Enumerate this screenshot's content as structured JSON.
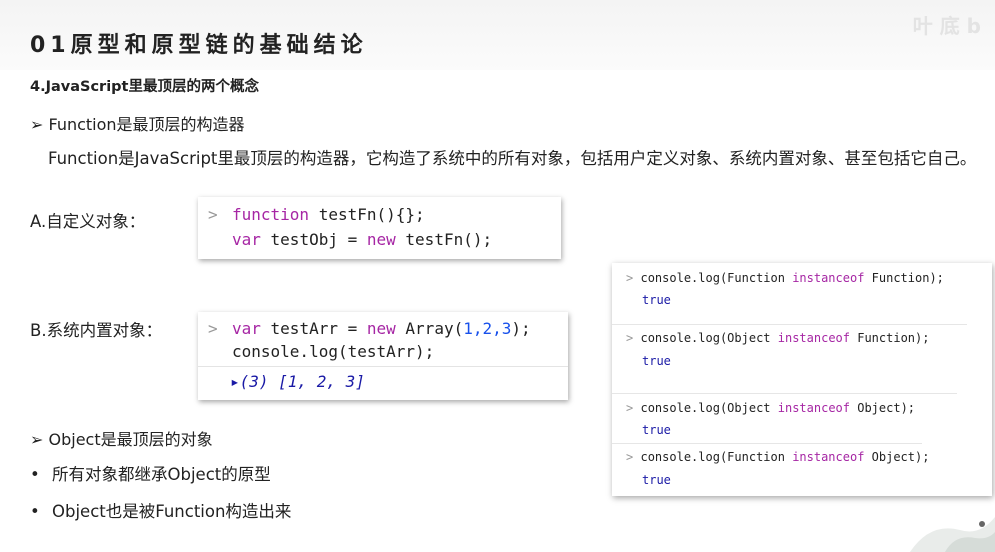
{
  "slide": {
    "title": "01原型和原型链的基础结论",
    "watermark": "叶 底 b",
    "subtitle": "4.JavaScript里最顶层的两个概念",
    "point1": "➢ Function是最顶层的构造器",
    "paragraph": "Function是JavaScript里最顶层的构造器，它构造了系统中的所有对象，包括用户定义对象、系统内置对象、甚至包括它自己。",
    "label_a": "A.自定义对象：",
    "label_b": "B.系统内置对象：",
    "point2": "➢ Object是最顶层的对象",
    "bullets": [
      "所有对象都继承Object的原型",
      "Object也是被Function构造出来"
    ],
    "bullet_char": "•"
  },
  "code_a": {
    "prompt": ">",
    "line1_kw": "function",
    "line1_rest": " testFn(){};",
    "line2_kw": "var",
    "line2_mid": " testObj = ",
    "line2_kw2": "new",
    "line2_rest": " testFn();"
  },
  "code_b": {
    "prompt": ">",
    "line1_kw": "var",
    "line1_mid": " testArr = ",
    "line1_kw2": "new",
    "line1_arr": " Array(",
    "line1_args": "1,2,3",
    "line1_end": ");",
    "line2": "console.log(testArr);",
    "output": "▸(3) [1, 2, 3]"
  },
  "console": {
    "prompt": ">",
    "entries": [
      {
        "pre": "console.log(Function ",
        "kw": "instanceof",
        "post": " Function);",
        "result": "true"
      },
      {
        "pre": "console.log(Object ",
        "kw": "instanceof",
        "post": " Function);",
        "result": "true"
      },
      {
        "pre": "console.log(Object ",
        "kw": "instanceof",
        "post": " Object);",
        "result": "true"
      },
      {
        "pre": "console.log(Function ",
        "kw": "instanceof",
        "post": " Object);",
        "result": "true"
      }
    ]
  }
}
